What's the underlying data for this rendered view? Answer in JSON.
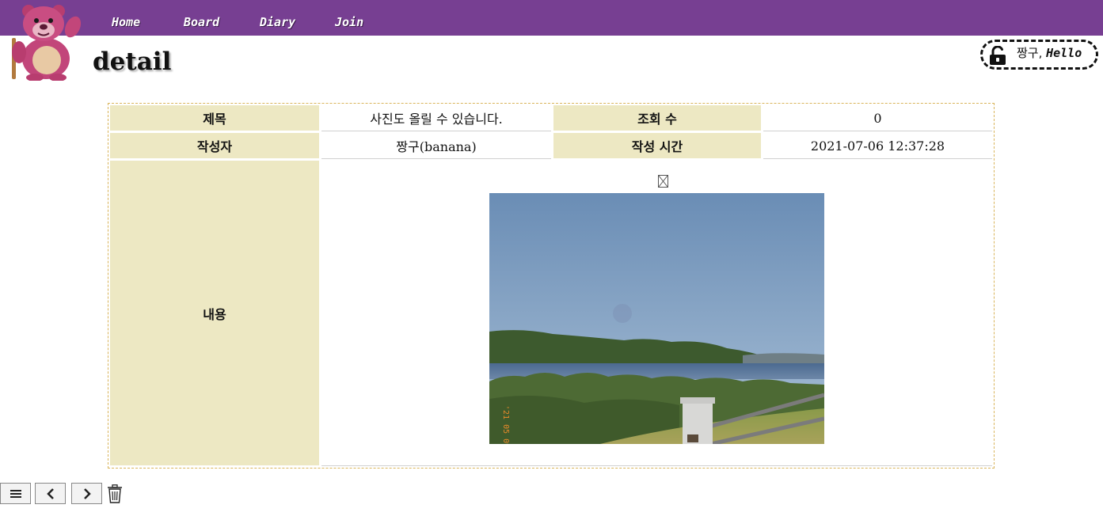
{
  "nav": {
    "items": [
      {
        "label": "Home"
      },
      {
        "label": "Board"
      },
      {
        "label": "Diary"
      },
      {
        "label": "Join"
      }
    ]
  },
  "page": {
    "title": "detail"
  },
  "user": {
    "name": "짱구,",
    "greeting": "Hello"
  },
  "post": {
    "title_label": "제목",
    "title": "사진도 올릴 수 있습니다.",
    "views_label": "조회 수",
    "views": "0",
    "author_label": "작성자",
    "author": "짱구(banana)",
    "time_label": "작성 시간",
    "time": "2021-07-06 12:37:28",
    "content_label": "내용",
    "photo_stamp": "'21 05 09"
  },
  "icons": {
    "logo": "bear-mascot-icon",
    "lock": "unlock-icon",
    "list": "list-icon",
    "prev": "chevron-left-icon",
    "next": "chevron-right-icon",
    "delete": "trash-icon",
    "broken_image": "broken-image-icon"
  },
  "colors": {
    "navbar": "#773f92",
    "label_bg": "#ede8c3",
    "table_border": "#d9b45a"
  }
}
